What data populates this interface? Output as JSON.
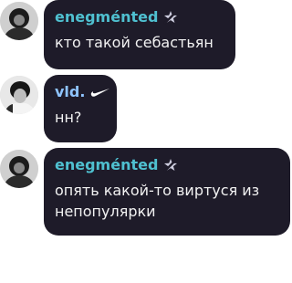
{
  "messages": [
    {
      "author": "enegménted",
      "author_color": "#4fc0d0",
      "badge_icon": "star-slash-icon",
      "text_lines": [
        "кто такой себастьян"
      ]
    },
    {
      "author": "vld.",
      "author_color": "#8fc4ff",
      "badge_icon": "swoosh-icon",
      "text_lines": [
        "нн?"
      ]
    },
    {
      "author": "enegménted",
      "author_color": "#4fc0d0",
      "badge_icon": "star-slash-icon",
      "text_lines": [
        "опять какой-то виртуся из",
        "непопулярки"
      ]
    }
  ]
}
